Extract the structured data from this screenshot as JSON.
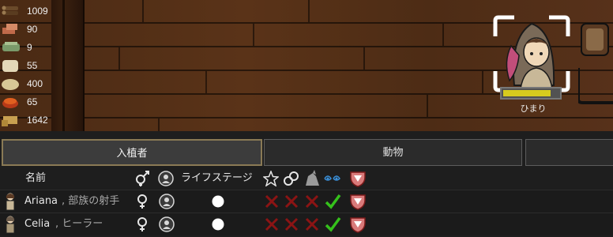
{
  "resources": [
    {
      "icon": "wood-log-icon",
      "value": "1009"
    },
    {
      "icon": "steel-icon",
      "value": "90"
    },
    {
      "icon": "silver-icon",
      "value": "9"
    },
    {
      "icon": "cloth-icon",
      "value": "55"
    },
    {
      "icon": "rice-icon",
      "value": "400"
    },
    {
      "icon": "meal-icon",
      "value": "65"
    },
    {
      "icon": "pemmican-icon",
      "value": "1642"
    }
  ],
  "pawn": {
    "name": "ひまり",
    "health": 0.85,
    "bar_color": "#d7cb1e"
  },
  "tabs": {
    "colonists": "入植者",
    "animals": "動物",
    "third": ""
  },
  "table": {
    "name_header": "名前",
    "life_stage_header": "ライフステージ",
    "rows": [
      {
        "name": "Ariana",
        "title": ", 部族の射手"
      },
      {
        "name": "Celia",
        "title": ", ヒーラー"
      }
    ]
  },
  "colors": {
    "cross": "#8b1414",
    "check": "#35c11b",
    "tab_highlight": "#8a7a55"
  }
}
